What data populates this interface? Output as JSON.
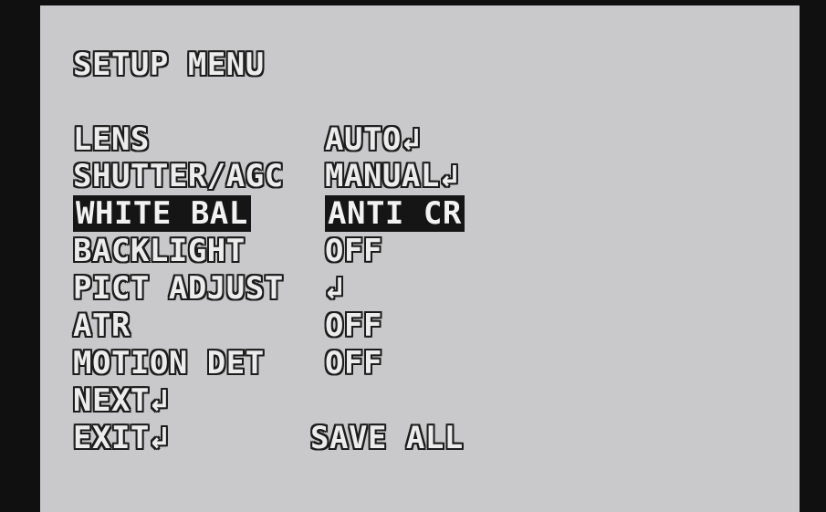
{
  "menu": {
    "title": "SETUP MENU",
    "items": [
      {
        "label": "LENS",
        "value": "AUTO↲"
      },
      {
        "label": "SHUTTER/AGC",
        "value": "MANUAL↲"
      },
      {
        "label": "WHITE BAL",
        "value": "ANTI CR"
      },
      {
        "label": "BACKLIGHT",
        "value": "OFF"
      },
      {
        "label": "PICT ADJUST",
        "value": "↲"
      },
      {
        "label": "ATR",
        "value": "OFF"
      },
      {
        "label": "MOTION DET",
        "value": "OFF"
      },
      {
        "label": "NEXT↲",
        "value": ""
      },
      {
        "label": "EXIT↲",
        "value": "SAVE ALL"
      }
    ],
    "selected_item": "WHITE BAL"
  }
}
